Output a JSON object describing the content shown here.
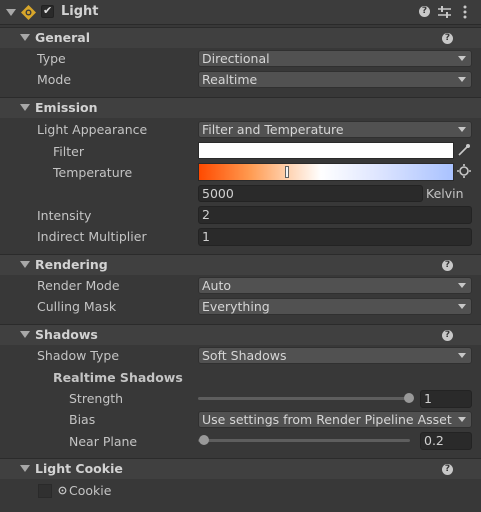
{
  "component": {
    "title": "Light",
    "enabled": true,
    "icons": {
      "help": "help-icon",
      "presets": "presets-icon",
      "menu": "kebab-menu-icon"
    }
  },
  "general": {
    "title": "General",
    "type_label": "Type",
    "type_value": "Directional",
    "mode_label": "Mode",
    "mode_value": "Realtime"
  },
  "emission": {
    "title": "Emission",
    "appearance_label": "Light Appearance",
    "appearance_value": "Filter and Temperature",
    "filter_label": "Filter",
    "filter_color": "#ffffff",
    "temperature_label": "Temperature",
    "temperature_value": "5000",
    "temperature_unit": "Kelvin",
    "intensity_label": "Intensity",
    "intensity_value": "2",
    "indirect_label": "Indirect Multiplier",
    "indirect_value": "1"
  },
  "rendering": {
    "title": "Rendering",
    "render_mode_label": "Render Mode",
    "render_mode_value": "Auto",
    "culling_label": "Culling Mask",
    "culling_value": "Everything"
  },
  "shadows": {
    "title": "Shadows",
    "type_label": "Shadow Type",
    "type_value": "Soft Shadows",
    "realtime_label": "Realtime Shadows",
    "strength_label": "Strength",
    "strength_value": "1",
    "bias_label": "Bias",
    "bias_value": "Use settings from Render Pipeline Asset",
    "near_label": "Near Plane",
    "near_value": "0.2"
  },
  "cookie": {
    "title": "Light Cookie",
    "cookie_label": "Cookie"
  },
  "colors": {
    "accent_blue": "#5a8cd8",
    "temperature_warm": "#ff5a00",
    "temperature_cool": "#9ab8ff"
  }
}
